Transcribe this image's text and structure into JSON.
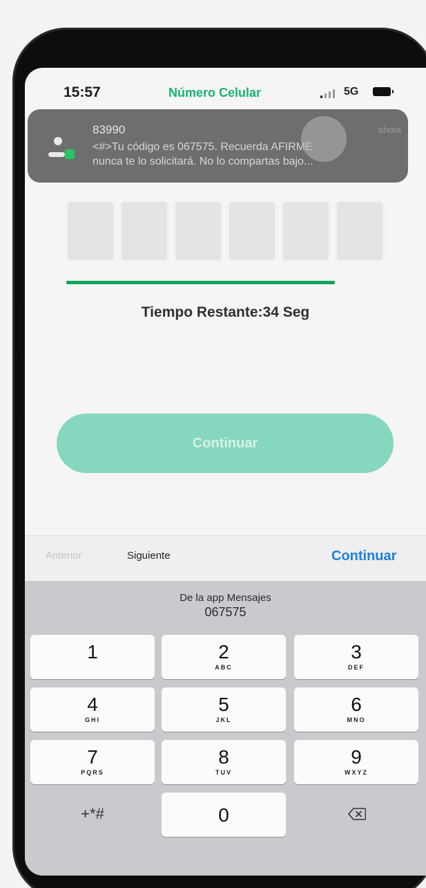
{
  "status_bar": {
    "time": "15:57",
    "title": "Número Celular",
    "network": "5G"
  },
  "notification": {
    "sender": "83990",
    "when": "ahora",
    "line1": "<#>Tu código es 067575. Recuerda AFIRME",
    "line2": "nunca te lo solicitará. No lo compartas bajo..."
  },
  "verification": {
    "timer": "Tiempo Restante:34 Seg",
    "progress": 0.76,
    "continue_label": "Continuar"
  },
  "keyboard_toolbar": {
    "prev_label": "Anterior",
    "next_label": "Siguiente",
    "done_label": "Continuar"
  },
  "suggestion": {
    "label": "De la app Mensajes",
    "code": "067575"
  },
  "keys": [
    {
      "num": "1",
      "letters": ""
    },
    {
      "num": "2",
      "letters": "ABC"
    },
    {
      "num": "3",
      "letters": "DEF"
    },
    {
      "num": "4",
      "letters": "GHI"
    },
    {
      "num": "5",
      "letters": "JKL"
    },
    {
      "num": "6",
      "letters": "MNO"
    },
    {
      "num": "7",
      "letters": "PQRS"
    },
    {
      "num": "8",
      "letters": "TUV"
    },
    {
      "num": "9",
      "letters": "WXYZ"
    },
    {
      "num": "0",
      "letters": ""
    }
  ],
  "special_keys": {
    "symbols": "+*#"
  },
  "colors": {
    "brand_green": "#17b474",
    "button_green": "#86d7bf",
    "progress_green": "#0fa35a",
    "link_blue": "#1a7fe0"
  }
}
